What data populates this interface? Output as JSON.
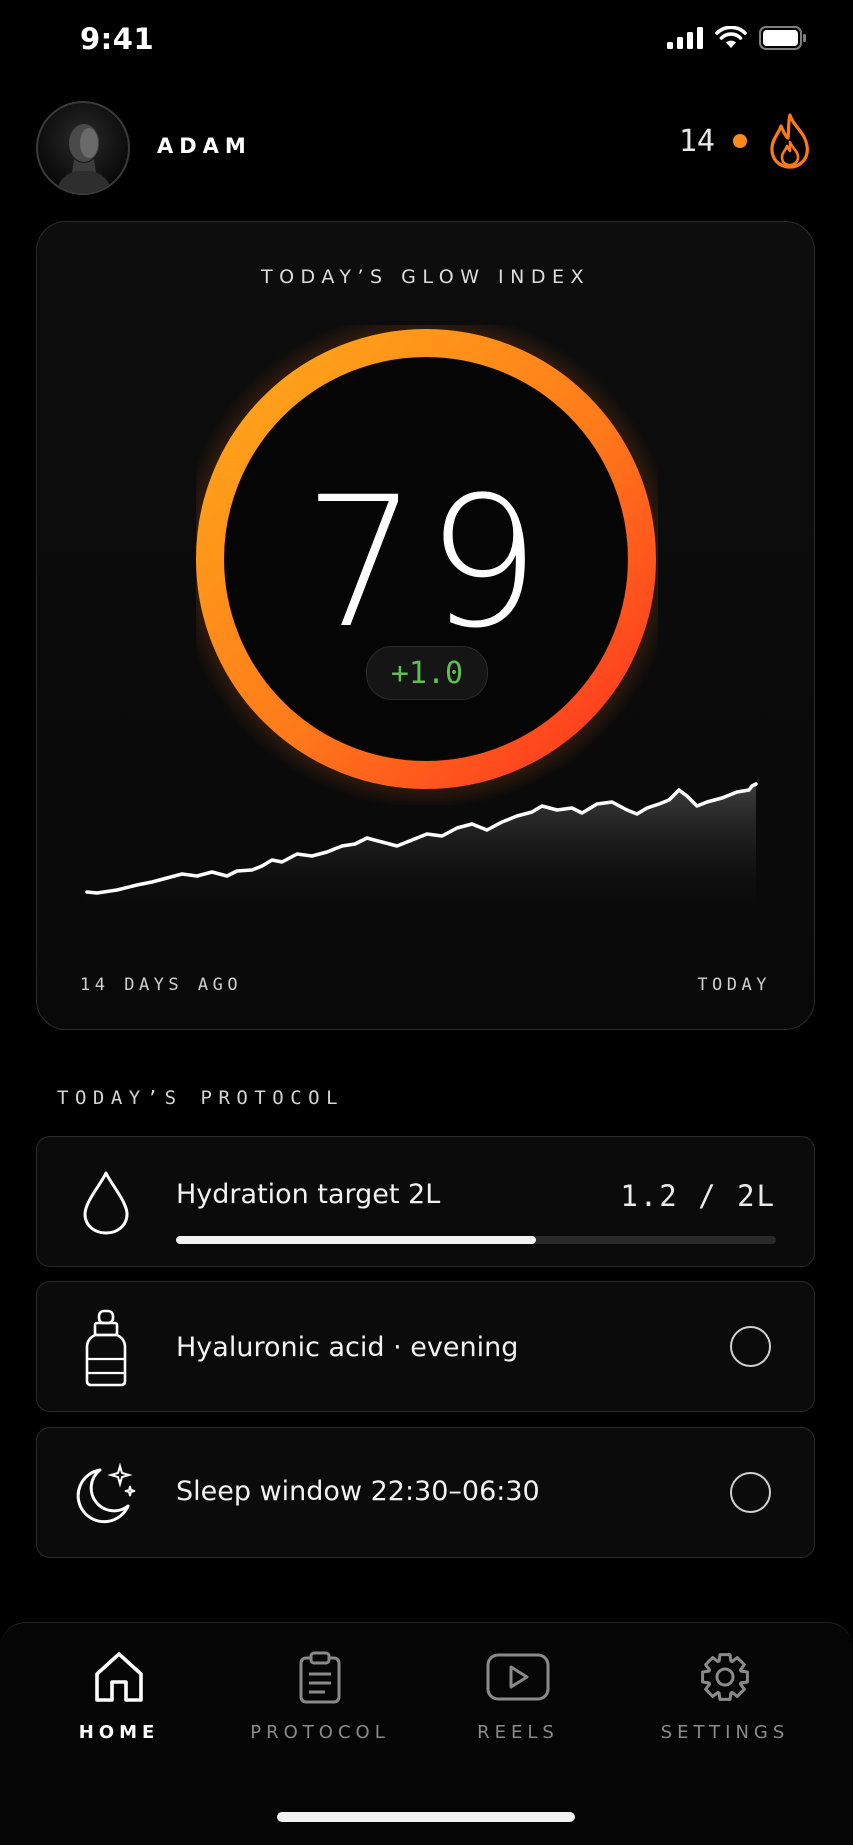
{
  "status_bar": {
    "time": "9:41"
  },
  "header": {
    "user_name": "ADAM",
    "streak_count": "14"
  },
  "glow_card": {
    "title": "TODAY’S GLOW INDEX",
    "score": "79",
    "score_fraction": 0.79,
    "delta": "+1.0",
    "trend_start_label": "14 DAYS AGO",
    "trend_end_label": "TODAY",
    "colors": {
      "gauge_start": "#ff9f1a",
      "gauge_end": "#ff3a1f",
      "delta": "#5fbf55"
    }
  },
  "protocol": {
    "title": "TODAY’S PROTOCOL",
    "items": [
      {
        "icon": "water-drop-icon",
        "label": "Hydration target 2L",
        "value": "1.2 / 2L",
        "progress": 0.6
      },
      {
        "icon": "serum-bottle-icon",
        "label": "Hyaluronic acid · evening",
        "done": false
      },
      {
        "icon": "moon-stars-icon",
        "label": "Sleep window 22:30–06:30",
        "done": false
      }
    ]
  },
  "tabs": [
    {
      "icon": "home-icon",
      "label": "HOME",
      "active": true
    },
    {
      "icon": "clipboard-icon",
      "label": "PROTOCOL",
      "active": false
    },
    {
      "icon": "play-icon",
      "label": "REELS",
      "active": false
    },
    {
      "icon": "gear-icon",
      "label": "SETTINGS",
      "active": false
    }
  ]
}
